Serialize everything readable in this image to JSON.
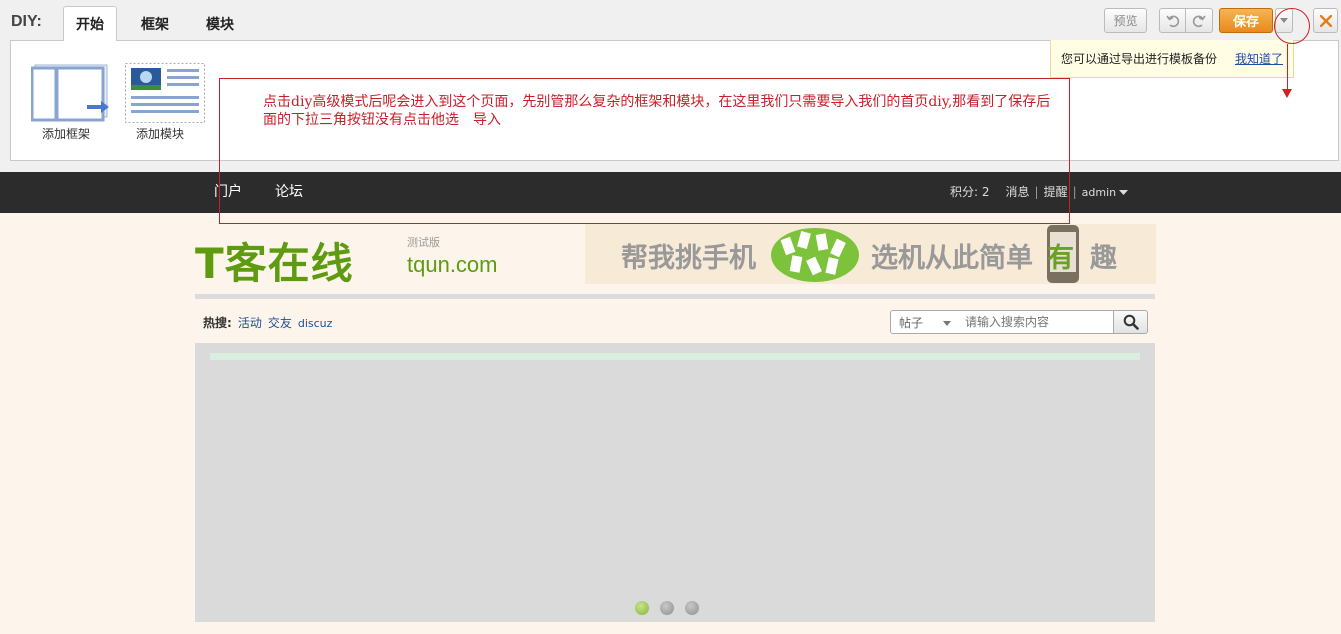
{
  "diy": {
    "label": "DIY:",
    "tabs": [
      {
        "label": "开始"
      },
      {
        "label": "框架"
      },
      {
        "label": "模块"
      }
    ],
    "tools": [
      {
        "label": "添加框架",
        "icon": "frame-icon"
      },
      {
        "label": "添加模块",
        "icon": "module-icon"
      }
    ],
    "toolbar": {
      "preview_label": "预览",
      "save_label": "保存"
    },
    "tip": {
      "text": "您可以通过导出进行模板备份",
      "link": "我知道了"
    }
  },
  "annotation": {
    "text": "点击diy高级模式后呢会进入到这个页面，先别管那么复杂的框架和模块，在这里我们只需要导入我们的首页diy,那看到了保存后面的下拉三角按钮没有点击他选　导入"
  },
  "nav": {
    "items": [
      {
        "label": "门户"
      },
      {
        "label": "论坛"
      }
    ],
    "credits": "积分: 2",
    "messages": "消息",
    "reminders": "提醒",
    "user": "admin"
  },
  "header": {
    "logo_main": "T客在线",
    "logo_sub": "tqun.com",
    "logo_badge": "测试版",
    "banner": {
      "part1": "帮我挑手机",
      "part2": "选机从此简单",
      "part3": "有",
      "part4": "趣"
    }
  },
  "hot_search": {
    "label": "热搜:",
    "links": [
      "活动",
      "交友",
      "discuz"
    ]
  },
  "search": {
    "type": "帖子",
    "placeholder": "请输入搜索内容"
  },
  "slideshow": {
    "dot_count": 3,
    "active_dot": 0
  },
  "colors": {
    "annotation": "#c8202a",
    "save_button": "#e8891d",
    "nav_bg": "#2c2c2c",
    "logo_green": "#5e9b10",
    "link_blue": "#1d5096"
  }
}
